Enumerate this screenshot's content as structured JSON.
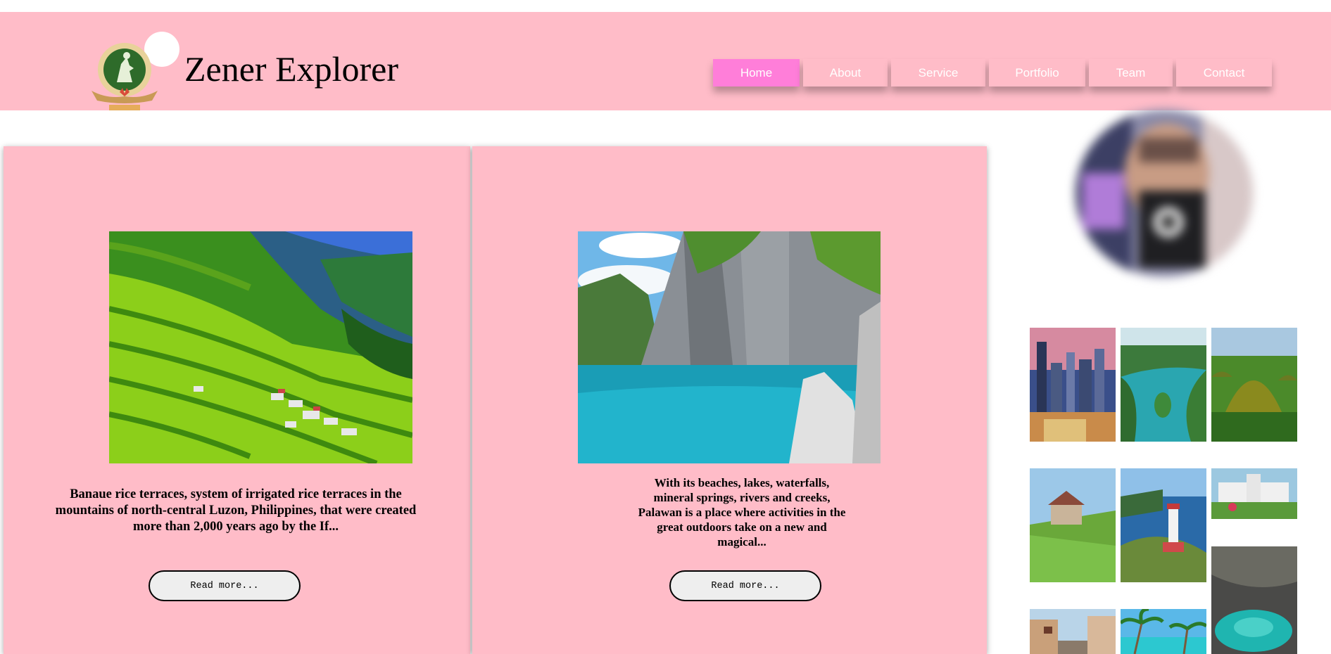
{
  "site": {
    "title": "Zener Explorer",
    "logo_icon": "explorer-emblem-logo"
  },
  "nav": {
    "items": [
      {
        "label": "Home",
        "active": true
      },
      {
        "label": "About",
        "active": false
      },
      {
        "label": "Service",
        "active": false
      },
      {
        "label": "Portfolio",
        "active": false
      },
      {
        "label": "Team",
        "active": false
      },
      {
        "label": "Contact",
        "active": false
      }
    ]
  },
  "cards": [
    {
      "image": "banaue-rice-terraces-photo",
      "text": "Banaue rice terraces, system of irrigated rice terraces in the mountains of north-central Luzon, Philippines, that were created more than 2,000 years ago by the If...",
      "button": "Read more..."
    },
    {
      "image": "palawan-lagoon-photo",
      "text": "With its beaches, lakes, waterfalls, mineral springs, rivers and creeks, Palawan is a place where activities in the great outdoors take on a new and magical...",
      "button": "Read more..."
    }
  ],
  "sidebar": {
    "avatar": "blurred-profile-photo",
    "gallery": [
      "city-skyline-photo",
      "green-islands-photo",
      "chocolate-hills-photo",
      "hillside-house-photo",
      "lighthouse-photo",
      "white-church-photo",
      "cave-pool-photo",
      "old-street-photo",
      "palm-beach-photo"
    ]
  },
  "colors": {
    "header": "#ffbcc8",
    "nav_active": "#ff7ed9",
    "card": "#ffbcc8"
  }
}
